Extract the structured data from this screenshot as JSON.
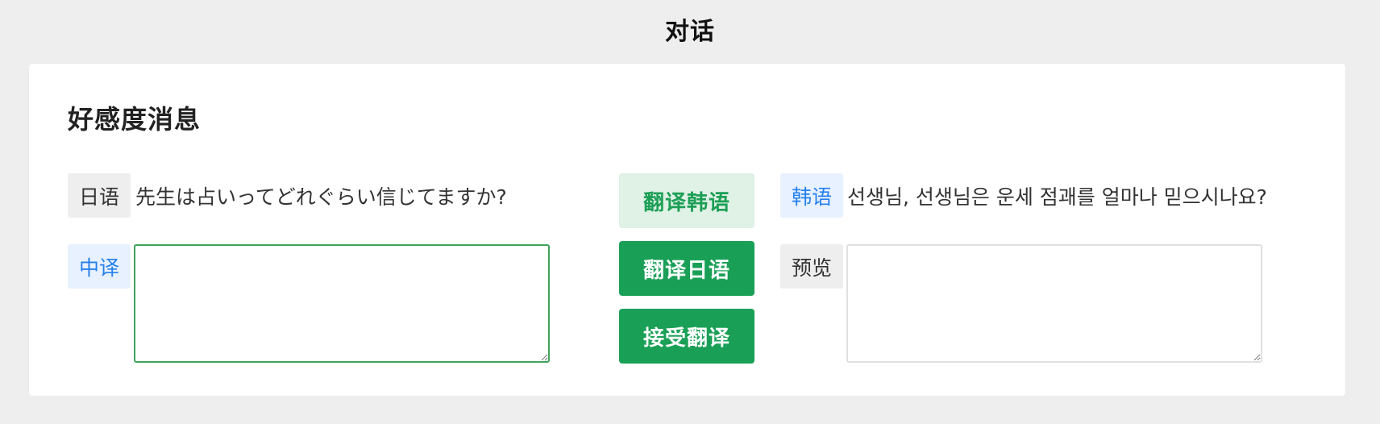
{
  "page": {
    "title": "对话"
  },
  "card": {
    "title": "好感度消息"
  },
  "source": {
    "tag": "日语",
    "text": "先生は占いってどれぐらい信じてますか?"
  },
  "chinese": {
    "tag": "中译",
    "value": "",
    "placeholder": ""
  },
  "korean": {
    "tag": "韩语",
    "text": "선생님, 선생님은 운세 점괘를 얼마나 믿으시나요?"
  },
  "preview": {
    "tag": "预览",
    "value": "",
    "placeholder": ""
  },
  "buttons": {
    "translate_korean": "翻译韩语",
    "translate_japanese": "翻译日语",
    "accept_translation": "接受翻译"
  },
  "colors": {
    "accent_green": "#1aa056",
    "light_green": "#e0f1e6",
    "tag_blue": "#2680eb"
  }
}
